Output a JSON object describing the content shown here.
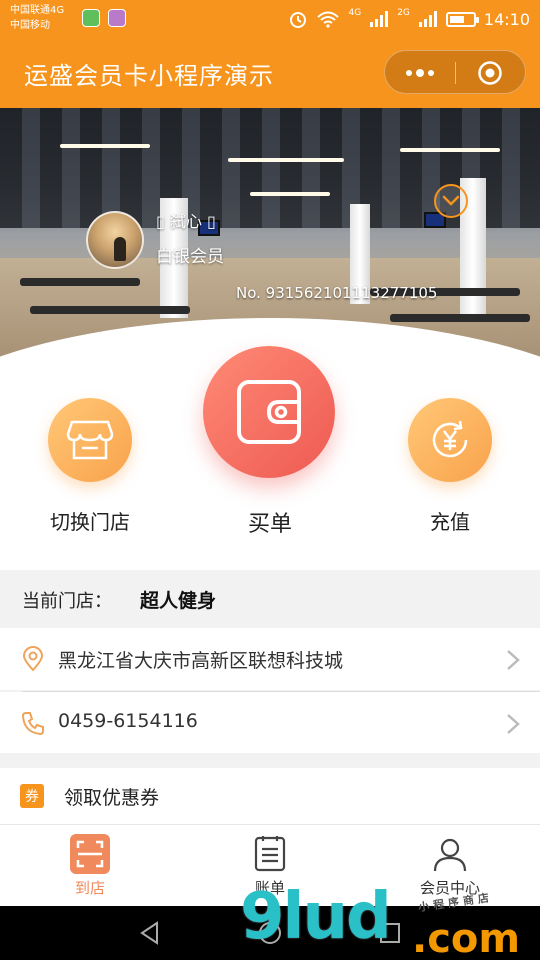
{
  "status_bar": {
    "carrier_1": "中国联通4G",
    "carrier_2": "中国移动",
    "net_1": "4G",
    "net_2": "2G",
    "time": "14:10"
  },
  "nav": {
    "title": "运盛会员卡小程序演示"
  },
  "member": {
    "name": "▯ 弑心 ▯",
    "level": "白银会员",
    "card_no": "No. 931562101113277105"
  },
  "actions": {
    "switch_store": "切换门店",
    "pay": "买单",
    "recharge": "充值"
  },
  "store": {
    "label": "当前门店：",
    "name": "超人健身",
    "address": "黑龙江省大庆市高新区联想科技城",
    "phone": "0459-6154116"
  },
  "coupon": {
    "badge": "券",
    "label": "领取优惠券"
  },
  "tabs": [
    {
      "label": "到店"
    },
    {
      "label": "账单"
    },
    {
      "label": "会员中心"
    }
  ],
  "watermark": {
    "main": "9lud",
    "domain": ".com",
    "sub": "小程序商店"
  },
  "colors": {
    "primary": "#f7941d",
    "pay_red": "#ee5a52",
    "action_orange": "#f9a24b",
    "tab_active": "#f08a5d"
  }
}
